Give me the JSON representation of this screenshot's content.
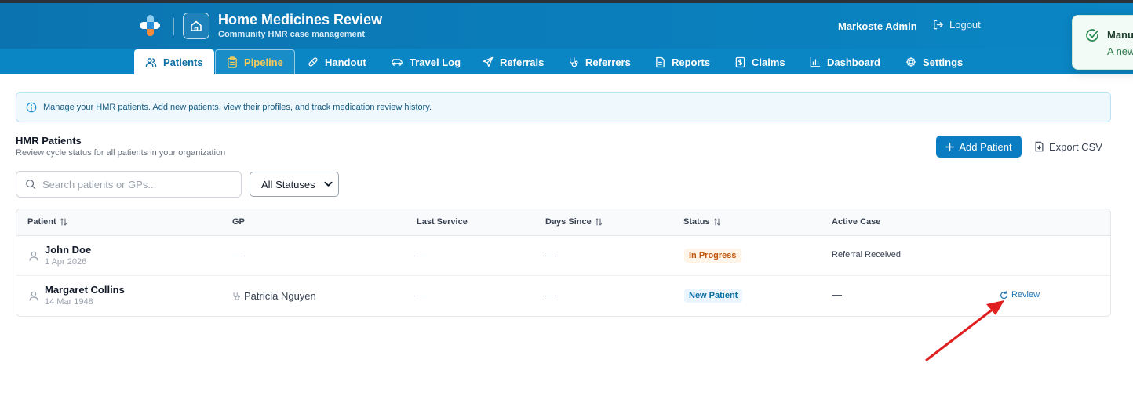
{
  "header": {
    "app_title": "Home Medicines Review",
    "app_subtitle": "Community HMR case management",
    "user_name": "Markoste Admin",
    "logout_label": "Logout"
  },
  "nav": {
    "tabs": [
      {
        "label": "Patients",
        "icon": "users-icon",
        "active": true
      },
      {
        "label": "Pipeline",
        "icon": "clipboard-icon",
        "highlighted": true
      },
      {
        "label": "Handout",
        "icon": "pill-icon"
      },
      {
        "label": "Travel Log",
        "icon": "car-icon"
      },
      {
        "label": "Referrals",
        "icon": "send-icon"
      },
      {
        "label": "Referrers",
        "icon": "stethoscope-icon"
      },
      {
        "label": "Reports",
        "icon": "file-icon"
      },
      {
        "label": "Claims",
        "icon": "dollar-icon"
      },
      {
        "label": "Dashboard",
        "icon": "bar-chart-icon"
      },
      {
        "label": "Settings",
        "icon": "gear-icon"
      }
    ]
  },
  "toast": {
    "title": "Manu",
    "body": "A new"
  },
  "info_banner": {
    "text": "Manage your HMR patients. Add new patients, view their profiles, and track medication review history."
  },
  "section": {
    "title": "HMR Patients",
    "subtitle": "Review cycle status for all patients in your organization",
    "add_button": "Add Patient",
    "export_button": "Export CSV"
  },
  "filters": {
    "search_placeholder": "Search patients or GPs...",
    "status_selected": "All Statuses"
  },
  "table": {
    "columns": [
      "Patient",
      "GP",
      "Last Service",
      "Days Since",
      "Status",
      "Active Case"
    ],
    "rows": [
      {
        "name": "John Doe",
        "dob": "1 Apr 2026",
        "gp": "—",
        "last_service": "—",
        "days_since": "—",
        "status": "In Progress",
        "active_case": "Referral Received",
        "action": ""
      },
      {
        "name": "Margaret Collins",
        "dob": "14 Mar 1948",
        "gp": "Patricia Nguyen",
        "last_service": "—",
        "days_since": "—",
        "status": "New Patient",
        "active_case": "—",
        "action": "Review"
      }
    ]
  },
  "colors": {
    "header_blue": "#0b74b0",
    "nav_blue": "#0a86c4",
    "primary": "#0a7cc1",
    "pipeline_gold": "#f7cb5a",
    "progress_orange": "#c2560c",
    "annotation_red": "#e02020"
  }
}
